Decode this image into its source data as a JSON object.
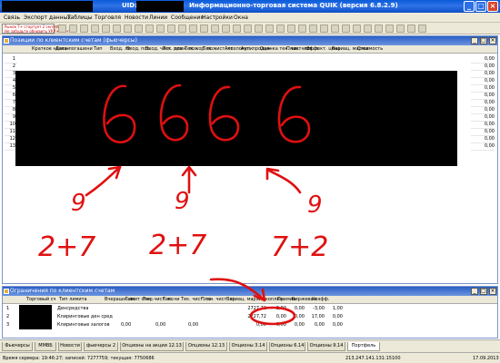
{
  "window": {
    "title_prefix": "UID:",
    "title": "Информационно-торговая система QUIK (версия 6.8.2.9)"
  },
  "menu": [
    "Связь",
    "Экспорт данных",
    "Таблицы",
    "Торговля",
    "Новости",
    "Линии",
    "Сообщения",
    "Настройки",
    "Окна"
  ],
  "ticker": {
    "line1": "Рынок Т+ стартует 2 сентября!",
    "line2": "Не забудьте обновить УРЛ клиент"
  },
  "positions": {
    "title": "Позиции по клиентским счетам (фьючерсы)",
    "columns": [
      "Краткое назван",
      "Дата погашени",
      "Тип",
      "Вход. ли",
      "Вход. поз.",
      "Вход. чист. поз.",
      "Тек. длин. поз.",
      "Тек. кор. поз.",
      "Тек. чист. поз.",
      "Акт. покупк",
      "Акт. продаж",
      "Оценка тек. чист. поз.",
      "План. чист. п.",
      "Эффект. цена",
      "Вариац. маржа",
      "Стоимость"
    ],
    "rows": [
      "1",
      "2",
      "3",
      "4",
      "5",
      "6",
      "7",
      "8",
      "9",
      "10",
      "11",
      "12",
      "13"
    ],
    "last_values": [
      "0,00",
      "0,00",
      "0,00",
      "0,00",
      "0,00",
      "0,00",
      "0,00",
      "0,00",
      "0,00",
      "0,00",
      "0,00",
      "0,00",
      "0,00"
    ]
  },
  "limits": {
    "title": "Ограничения по клиентским счетам",
    "columns": [
      "Торговый сч",
      "Тип лимита",
      "Вчерашн. ли",
      "Лимит откр.",
      "Тек. чист. по.",
      "Тек. чи",
      "Тек. чист. по",
      "План. чист. по",
      "Вариац. марж",
      "Накоплен.",
      "Премия",
      "Биржевые",
      "Коэфф."
    ],
    "rows": [
      {
        "n": "1",
        "type": "Денсредства",
        "var": "2727,72",
        "a": "-3,00",
        "b": "0,00",
        "c": "-3,00",
        "d": "1,00"
      },
      {
        "n": "2",
        "type": "Клиринговые ден сред",
        "var": "2727,72",
        "a": "0,00",
        "b": "0,00",
        "c": "17,00",
        "d": "0,00"
      },
      {
        "n": "3",
        "type": "Клиринговые залогов",
        "var": "0,00",
        "a": "0,00",
        "b": "0,00",
        "c": "0,00",
        "d": "0,00"
      }
    ],
    "zeros": "0,00"
  },
  "tabs": [
    "Фьючерсы",
    "ММВБ",
    "Новости",
    "фьючерсы 2",
    "Опционы на акции 12.13",
    "Опционы 12.13",
    "Опционы 3.14",
    "Опционы 6.14",
    "Опционы 9.14",
    "Портфель"
  ],
  "status": {
    "server_time": "Время сервера: 19:46:27; записей: 7277759; текущая: 7750686",
    "ip": "213.247.141.131:15100",
    "date": "17.09.2013"
  },
  "annotations": {
    "top": [
      "6",
      "66",
      "6"
    ],
    "middle": [
      "9",
      "9",
      "9"
    ],
    "bottom": [
      "2+7",
      "2+7",
      "7+2"
    ]
  },
  "colors": {
    "ink": "#e01010",
    "title_blue": "#2b5fc6"
  }
}
